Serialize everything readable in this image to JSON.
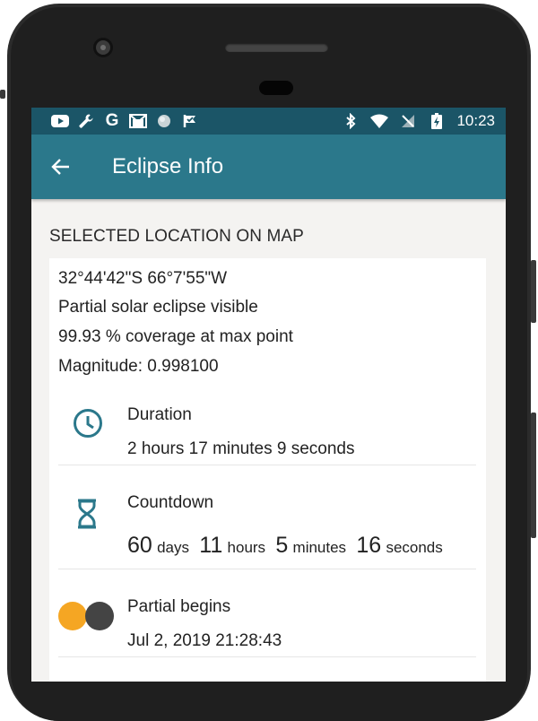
{
  "status_bar": {
    "time": "10:23",
    "left_icons": [
      "youtube-icon",
      "wrench-icon",
      "google-icon",
      "gmail-icon",
      "circle-icon",
      "flag-check-icon"
    ],
    "right_icons": [
      "bluetooth-icon",
      "wifi-icon",
      "no-signal-icon",
      "battery-charging-icon"
    ]
  },
  "app_bar": {
    "title": "Eclipse Info",
    "back_icon": "arrow-back-icon",
    "color": "#2b788b"
  },
  "section": {
    "header": "SELECTED LOCATION ON MAP"
  },
  "location": {
    "coordinates": "32°44'42\"S 66°7'55\"W",
    "visibility": "Partial solar eclipse visible",
    "coverage": "99.93 % coverage at max point",
    "magnitude": "Magnitude: 0.998100"
  },
  "duration": {
    "icon": "clock-icon",
    "label": "Duration",
    "value": "2 hours 17 minutes 9 seconds"
  },
  "countdown": {
    "icon": "hourglass-icon",
    "label": "Countdown",
    "days": "60",
    "days_unit": "days",
    "hours": "11",
    "hours_unit": "hours",
    "minutes": "5",
    "minutes_unit": "minutes",
    "seconds": "16",
    "seconds_unit": "seconds"
  },
  "partial_begins": {
    "icon": "partial-eclipse-icon",
    "label": "Partial begins",
    "value": "Jul 2, 2019 21:28:43"
  },
  "colors": {
    "status_bar": "#1b5567",
    "accent_icon": "#2b788b",
    "sun": "#f5a623",
    "moon": "#444444"
  }
}
